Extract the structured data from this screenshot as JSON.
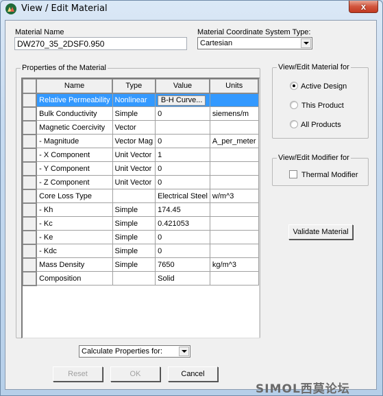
{
  "window": {
    "title": "View / Edit Material",
    "icon": "app-logo-icon",
    "close_label": "x"
  },
  "material_name": {
    "label": "Material Name",
    "value": "DW270_35_2DSF0.950"
  },
  "coordinate_system": {
    "label": "Material Coordinate System Type:",
    "selected": "Cartesian"
  },
  "properties": {
    "group_title": "Properties of the Material",
    "columns": [
      "Name",
      "Type",
      "Value",
      "Units"
    ],
    "rows": [
      {
        "name": "Relative Permeability",
        "type": "Nonlinear",
        "value": "B-H Curve...",
        "units": "",
        "selected": true,
        "value_is_button": true
      },
      {
        "name": "Bulk Conductivity",
        "type": "Simple",
        "value": "0",
        "units": "siemens/m"
      },
      {
        "name": "Magnetic Coercivity",
        "type": "Vector",
        "value": "",
        "units": ""
      },
      {
        "name": "-  Magnitude",
        "type": "Vector Mag",
        "value": "0",
        "units": "A_per_meter"
      },
      {
        "name": "-  X Component",
        "type": "Unit Vector",
        "value": "1",
        "units": ""
      },
      {
        "name": "-  Y Component",
        "type": "Unit Vector",
        "value": "0",
        "units": ""
      },
      {
        "name": "-  Z Component",
        "type": "Unit Vector",
        "value": "0",
        "units": ""
      },
      {
        "name": "Core Loss Type",
        "type": "",
        "value": "Electrical Steel",
        "units": "w/m^3"
      },
      {
        "name": "-  Kh",
        "type": "Simple",
        "value": "174.45",
        "units": ""
      },
      {
        "name": "-  Kc",
        "type": "Simple",
        "value": "0.421053",
        "units": ""
      },
      {
        "name": "-  Ke",
        "type": "Simple",
        "value": "0",
        "units": ""
      },
      {
        "name": "-  Kdc",
        "type": "Simple",
        "value": "0",
        "units": ""
      },
      {
        "name": "Mass Density",
        "type": "Simple",
        "value": "7650",
        "units": "kg/m^3"
      },
      {
        "name": "Composition",
        "type": "",
        "value": "Solid",
        "units": ""
      }
    ]
  },
  "view_edit_for": {
    "group_title": "View/Edit Material for",
    "options": [
      {
        "label": "Active Design",
        "checked": true
      },
      {
        "label": "This Product",
        "checked": false
      },
      {
        "label": "All Products",
        "checked": false
      }
    ]
  },
  "modifier_for": {
    "group_title": "View/Edit Modifier for",
    "thermal_label": "Thermal Modifier",
    "thermal_checked": false
  },
  "validate_button": "Validate Material",
  "calculate_properties": {
    "selected": "Calculate Properties for:"
  },
  "buttons": {
    "reset": "Reset",
    "ok": "OK",
    "cancel": "Cancel"
  },
  "watermark": "SIMOL西莫论坛"
}
